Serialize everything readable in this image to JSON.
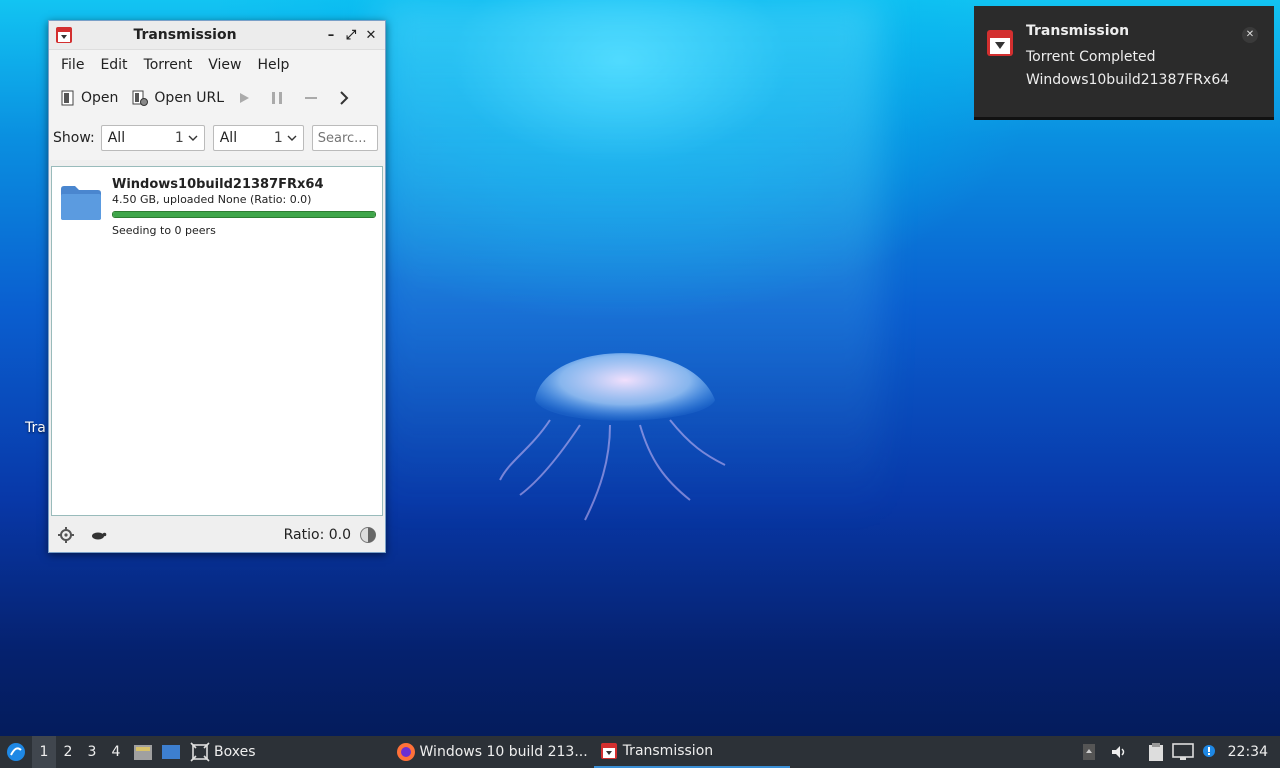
{
  "window": {
    "title": "Transmission",
    "menu": [
      "File",
      "Edit",
      "Torrent",
      "View",
      "Help"
    ],
    "toolbar": {
      "open_label": "Open",
      "open_url_label": "Open URL"
    },
    "filter": {
      "show_label": "Show:",
      "status_value": "All",
      "status_count": "1",
      "tracker_value": "All",
      "tracker_count": "1",
      "search_placeholder": "Searc..."
    },
    "torrents": [
      {
        "name": "Windows10build21387FRx64",
        "meta": "4.50 GB, uploaded None (Ratio: 0.0)",
        "progress": 1.0,
        "status": "Seeding to 0 peers"
      }
    ],
    "statusbar": {
      "ratio": "Ratio: 0.0"
    }
  },
  "notification": {
    "title": "Transmission",
    "line1": "Torrent Completed",
    "line2": "Windows10build21387FRx64"
  },
  "desktop": {
    "label_partial": "Tra"
  },
  "taskbar": {
    "desktops": [
      "1",
      "2",
      "3",
      "4"
    ],
    "boxes_label": "Boxes",
    "firefox_label": "Windows 10 build 213...",
    "transmission_label": "Transmission",
    "clock": "22:34"
  },
  "colors": {
    "accent": "#3a8fd6",
    "progress": "#3fa64a",
    "taskbar": "#2c3137"
  }
}
